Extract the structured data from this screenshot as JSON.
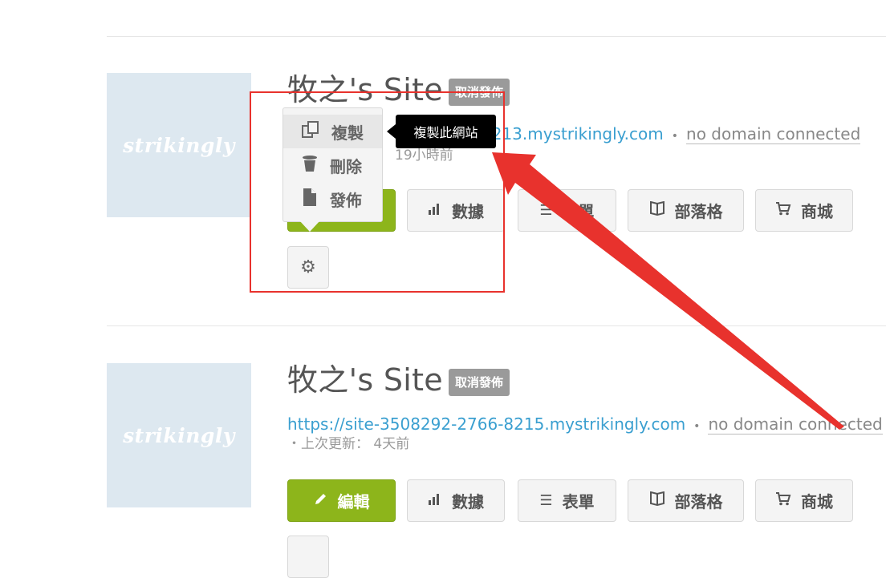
{
  "thumbnail_logo": "strikingly",
  "sites": [
    {
      "title": "牧之's Site",
      "status_badge": "取消發佈",
      "url_visible": "2213.mystrikingly.com",
      "domain_status": "no domain connected",
      "updated_visible": "19小時前",
      "actions": {
        "analytics": "數據",
        "forms": "表單",
        "blog": "部落格",
        "store": "商城"
      }
    },
    {
      "title": "牧之's Site",
      "status_badge": "取消發佈",
      "url": "https://site-3508292-2766-8215.mystrikingly.com",
      "domain_status": "no domain connected",
      "updated_label": "上次更新：",
      "updated_value": "4天前",
      "actions": {
        "edit": "編輯",
        "analytics": "數據",
        "forms": "表單",
        "blog": "部落格",
        "store": "商城"
      }
    }
  ],
  "menu": {
    "items": [
      {
        "label": "複製",
        "icon": "copy-icon"
      },
      {
        "label": "刪除",
        "icon": "trash-icon"
      },
      {
        "label": "發佈",
        "icon": "file-icon"
      }
    ]
  },
  "tooltip": "複製此網站",
  "annotation_color": "#e8322d",
  "edit_button_color": "#8db51b"
}
